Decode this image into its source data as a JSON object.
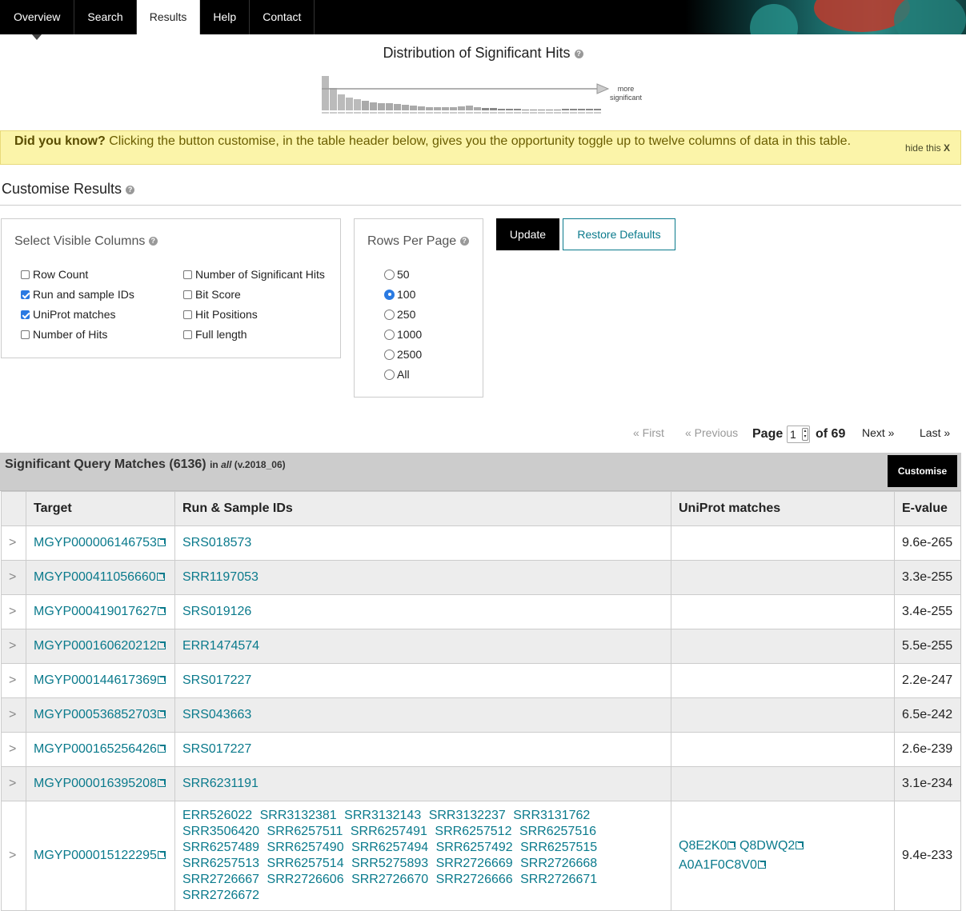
{
  "nav": {
    "tabs": [
      {
        "label": "Overview"
      },
      {
        "label": "Search"
      },
      {
        "label": "Results"
      },
      {
        "label": "Help"
      },
      {
        "label": "Contact"
      }
    ],
    "active": "Results"
  },
  "distribution": {
    "title": "Distribution of Significant Hits",
    "arrow_label_line1": "more",
    "arrow_label_line2": "significant"
  },
  "did_you_know": {
    "lead": "Did you know?",
    "text": " Clicking the button customise, in the table header below, gives you the opportunity toggle up to twelve columns of data in this table.",
    "hide_label": "hide this ",
    "hide_x": "X"
  },
  "customise": {
    "title": "Customise Results",
    "columns_title": "Select Visible Columns",
    "columns": [
      {
        "label": "Row Count",
        "checked": false
      },
      {
        "label": "Run and sample IDs",
        "checked": true
      },
      {
        "label": "UniProt matches",
        "checked": true
      },
      {
        "label": "Number of Hits",
        "checked": false
      },
      {
        "label": "Number of Significant Hits",
        "checked": false
      },
      {
        "label": "Bit Score",
        "checked": false
      },
      {
        "label": "Hit Positions",
        "checked": false
      },
      {
        "label": "Full length",
        "checked": false
      }
    ],
    "rows_title": "Rows Per Page",
    "rows_options": [
      "50",
      "100",
      "250",
      "1000",
      "2500",
      "All"
    ],
    "rows_selected": "100",
    "update_label": "Update",
    "restore_label": "Restore Defaults"
  },
  "pager": {
    "first": "« First",
    "previous": "« Previous",
    "page_label": "Page",
    "page_value": "1",
    "of_label": "of 69",
    "next": "Next »",
    "last": "Last »"
  },
  "results": {
    "title": "Significant Query Matches (6136)",
    "in_label": "in",
    "db": "all",
    "version": "(v.2018_06)",
    "customise_label": "Customise",
    "headers": [
      "Target",
      "Run & Sample IDs",
      "UniProt matches",
      "E-value"
    ],
    "expand_glyph": ">",
    "rows": [
      {
        "target": "MGYP000006146753",
        "runs": [
          "SRS018573"
        ],
        "uniprot": [],
        "evalue": "9.6e-265"
      },
      {
        "target": "MGYP000411056660",
        "runs": [
          "SRR1197053"
        ],
        "uniprot": [],
        "evalue": "3.3e-255"
      },
      {
        "target": "MGYP000419017627",
        "runs": [
          "SRS019126"
        ],
        "uniprot": [],
        "evalue": "3.4e-255"
      },
      {
        "target": "MGYP000160620212",
        "runs": [
          "ERR1474574"
        ],
        "uniprot": [],
        "evalue": "5.5e-255"
      },
      {
        "target": "MGYP000144617369",
        "runs": [
          "SRS017227"
        ],
        "uniprot": [],
        "evalue": "2.2e-247"
      },
      {
        "target": "MGYP000536852703",
        "runs": [
          "SRS043663"
        ],
        "uniprot": [],
        "evalue": "6.5e-242"
      },
      {
        "target": "MGYP000165256426",
        "runs": [
          "SRS017227"
        ],
        "uniprot": [],
        "evalue": "2.6e-239"
      },
      {
        "target": "MGYP000016395208",
        "runs": [
          "SRR6231191"
        ],
        "uniprot": [],
        "evalue": "3.1e-234"
      },
      {
        "target": "MGYP000015122295",
        "runs": [
          "ERR526022",
          "SRR3132381",
          "SRR3132143",
          "SRR3132237",
          "SRR3131762",
          "SRR3506420",
          "SRR6257511",
          "SRR6257491",
          "SRR6257512",
          "SRR6257516",
          "SRR6257489",
          "SRR6257490",
          "SRR6257494",
          "SRR6257492",
          "SRR6257515",
          "SRR6257513",
          "SRR6257514",
          "SRR5275893",
          "SRR2726669",
          "SRR2726668",
          "SRR2726667",
          "SRR2726606",
          "SRR2726670",
          "SRR2726666",
          "SRR2726671",
          "SRR2726672"
        ],
        "uniprot": [
          "Q8E2K0",
          "Q8DWQ2",
          "A0A1F0C8V0"
        ],
        "evalue": "9.4e-233"
      }
    ]
  }
}
